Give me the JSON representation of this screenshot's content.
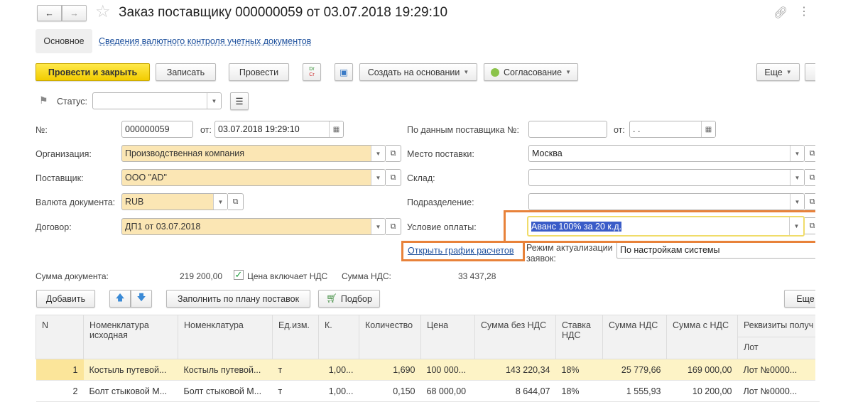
{
  "title": "Заказ поставщику 000000059 от 03.07.2018 19:29:10",
  "tabs": {
    "main": "Основное",
    "link": "Сведения валютного контроля учетных документов"
  },
  "toolbar": {
    "post_close": "Провести и закрыть",
    "save": "Записать",
    "post": "Провести",
    "dr": "Dr",
    "cr": "Cr",
    "create_based": "Создать на основании",
    "approval": "Согласование",
    "more": "Еще"
  },
  "status": {
    "label": "Статус:",
    "value": ""
  },
  "left": {
    "num_label": "№:",
    "num": "000000059",
    "from_label": "от:",
    "date": "03.07.2018 19:29:10",
    "org_label": "Организация:",
    "org": "Производственная компания",
    "supplier_label": "Поставщик:",
    "supplier": "ООО \"AD\"",
    "currency_label": "Валюта документа:",
    "currency": "RUB",
    "contract_label": "Договор:",
    "contract": "ДП1 от 03.07.2018"
  },
  "right": {
    "supnum_label": "По данным поставщика №:",
    "supnum": "",
    "from_label": "от:",
    "supdate": " .  .",
    "place_label": "Место поставки:",
    "place": "Москва",
    "warehouse_label": "Склад:",
    "warehouse": "",
    "dept_label": "Подразделение:",
    "dept": "",
    "payterm_label": "Условие оплаты:",
    "payterm": "Аванс 100% за 20 к.д.",
    "schedule_link": "Открыть график расчетов",
    "mode_label1": "Режим актуализации",
    "mode_label2": "заявок:",
    "mode": "По настройкам системы"
  },
  "totals": {
    "sum_label": "Сумма документа:",
    "sum": "219 200,00",
    "vat_incl": "Цена включает НДС",
    "vat_label": "Сумма НДС:",
    "vat": "33 437,28"
  },
  "table_toolbar": {
    "add": "Добавить",
    "fill": "Заполнить по плану поставок",
    "pick": "Подбор",
    "more": "Еще"
  },
  "table": {
    "headers": [
      "N",
      "Номенклатура исходная",
      "Номенклатура",
      "Ед.изм.",
      "К.",
      "Количество",
      "Цена",
      "Сумма без НДС",
      "Ставка НДС",
      "Сумма НДС",
      "Сумма с НДС",
      "Реквизиты получ"
    ],
    "subheader": "Лот",
    "rows": [
      [
        "1",
        "Костыль путевой...",
        "Костыль путевой...",
        "т",
        "1,00...",
        "1,690",
        "100 000...",
        "143 220,34",
        "18%",
        "25 779,66",
        "169 000,00",
        "Лот №0000..."
      ],
      [
        "2",
        "Болт стыковой М...",
        "Болт стыковой М...",
        "т",
        "1,00...",
        "0,150",
        "68 000,00",
        "8 644,07",
        "18%",
        "1 555,93",
        "10 200,00",
        "Лот №0000..."
      ]
    ]
  }
}
